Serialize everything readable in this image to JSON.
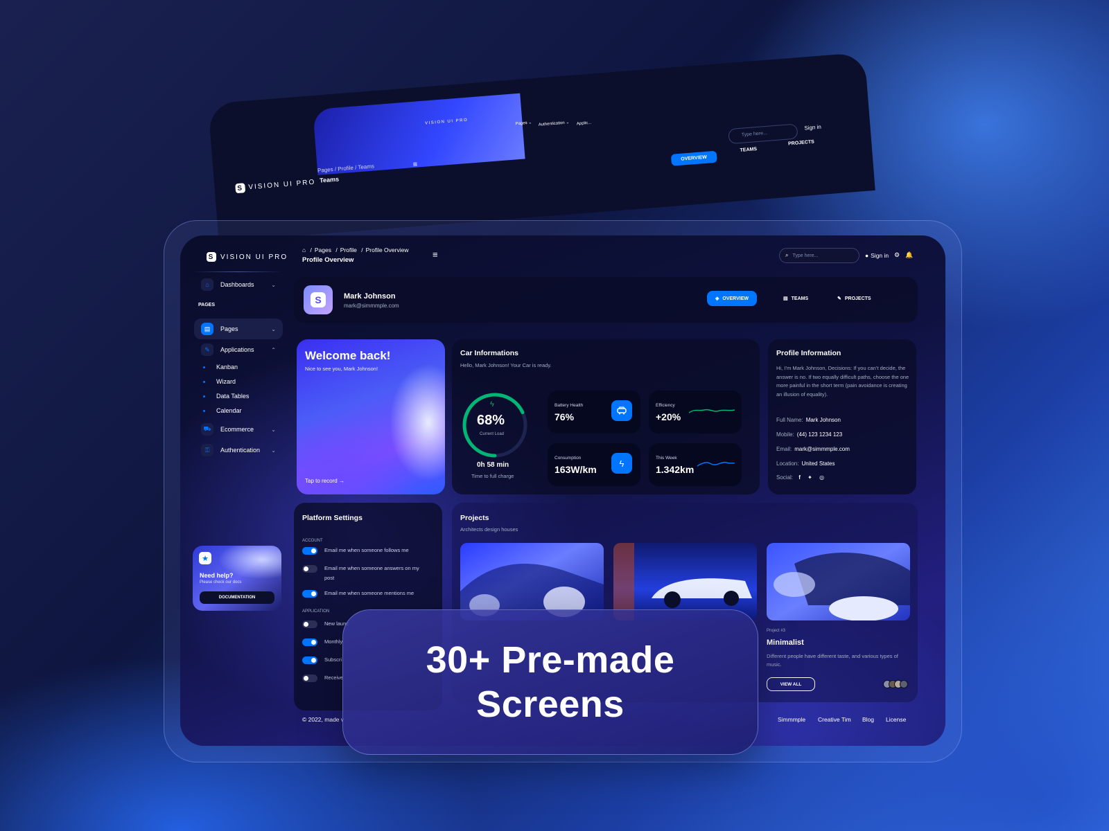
{
  "back_screen": {
    "logo": "VISION UI PRO",
    "banner_logo": "VISION UI PRO",
    "banner_nav": [
      "Pages ⌄",
      "Authentication ⌄",
      "Applic..."
    ],
    "breadcrumb": "Pages  /  Profile  /  Teams",
    "title": "Teams",
    "search_placeholder": "Type here...",
    "sign_in": "Sign in",
    "tabs": {
      "overview": "OVERVIEW",
      "teams": "TEAMS",
      "projects": "PROJECTS"
    }
  },
  "sidebar": {
    "logo": "VISION UI PRO",
    "dashboards": "Dashboards",
    "section_pages": "PAGES",
    "pages": "Pages",
    "applications": "Applications",
    "app_items": [
      "Kanban",
      "Wizard",
      "Data Tables",
      "Calendar"
    ],
    "ecommerce": "Ecommerce",
    "authentication": "Authentication",
    "help": {
      "title": "Need help?",
      "subtitle": "Please check our docs",
      "button": "DOCUMENTATION"
    }
  },
  "topbar": {
    "breadcrumb": [
      "Pages",
      "Profile",
      "Profile Overview"
    ],
    "title": "Profile Overview",
    "search_placeholder": "Type here...",
    "sign_in": "Sign in"
  },
  "profile_header": {
    "name": "Mark Johnson",
    "email": "mark@simmmple.com",
    "tabs": {
      "overview": "OVERVIEW",
      "teams": "TEAMS",
      "projects": "PROJECTS"
    }
  },
  "welcome": {
    "title": "Welcome back!",
    "subtitle": "Nice to see you, Mark Johnson!",
    "link": "Tap to record"
  },
  "car_info": {
    "title": "Car Informations",
    "subtitle": "Hello, Mark Johnson! Your Car is ready.",
    "gauge": {
      "value": "68%",
      "label": "Current Load",
      "fraction": 0.68
    },
    "charge_time": "0h 58 min",
    "charge_label": "Time to full charge",
    "stats": [
      {
        "label": "Battery Health",
        "value": "76%"
      },
      {
        "label": "Efficiency",
        "value": "+20%"
      },
      {
        "label": "Consumption",
        "value": "163W/km"
      },
      {
        "label": "This Week",
        "value": "1.342km"
      }
    ]
  },
  "profile_info": {
    "title": "Profile Information",
    "bio": "Hi, I’m Mark Johnson, Decisions: If you can’t decide, the answer is no. If two equally difficult paths, choose the one more painful in the short term (pain avoidance is creating an illusion of equality).",
    "full_name_label": "Full Name:",
    "full_name": "Mark Johnson",
    "mobile_label": "Mobile:",
    "mobile": "(44) 123 1234 123",
    "email_label": "Email:",
    "email": "mark@simmmple.com",
    "location_label": "Location:",
    "location": "United States",
    "social_label": "Social:"
  },
  "platform_settings": {
    "title": "Platform Settings",
    "account_label": "ACCOUNT",
    "account_items": [
      {
        "label": "Email me when someone follows me",
        "on": true
      },
      {
        "label": "Email me when someone answers on my post",
        "on": false
      },
      {
        "label": "Email me when someone mentions me",
        "on": true
      }
    ],
    "application_label": "APPLICATION",
    "application_items": [
      {
        "label": "New launc",
        "on": false
      },
      {
        "label": "Monthly",
        "on": true
      },
      {
        "label": "Subscri",
        "on": true
      },
      {
        "label": "Receive",
        "on": false
      }
    ]
  },
  "projects": {
    "title": "Projects",
    "subtitle": "Architects design houses",
    "card3": {
      "tag": "Project #3",
      "name": "Minimalist",
      "description": "Different people have different taste, and various types of music.",
      "button": "VIEW ALL"
    }
  },
  "footer": {
    "copyright": "© 2022, made v",
    "links": [
      "Simmmple",
      "Creative Tim",
      "Blog",
      "License"
    ]
  },
  "overlay": {
    "text": "30+ Pre-made\nScreens"
  },
  "colors": {
    "accent": "#0075ff",
    "gauge": "#01b574",
    "card": "#060b28"
  }
}
